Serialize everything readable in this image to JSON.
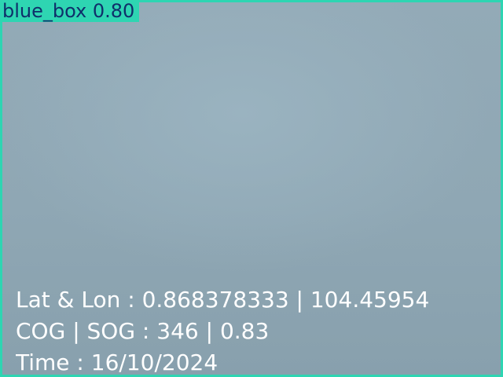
{
  "detection": {
    "label": "blue_box 0.80",
    "box_color": "#2ed5b2",
    "label_text_color": "#0f2f6a"
  },
  "telemetry": {
    "lat_lon": "Lat & Lon : 0.868378333 | 104.45954",
    "cog_sog": "COG | SOG : 346 | 0.83",
    "time": "Time : 16/10/2024"
  }
}
